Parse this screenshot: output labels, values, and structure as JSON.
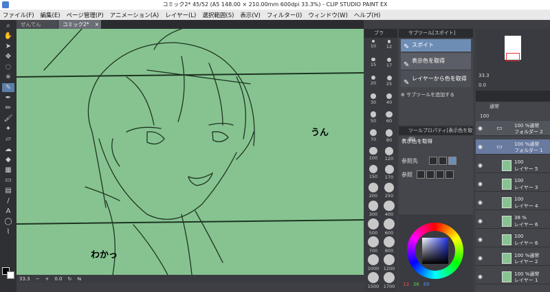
{
  "title": "コミック2* 45/52 (A5 148.00 × 210.00mm 600dpi 33.3%) - CLIP STUDIO PAINT EX",
  "menu": [
    "ファイル(F)",
    "編集(E)",
    "ページ管理(P)",
    "アニメーション(A)",
    "レイヤー(L)",
    "選択範囲(S)",
    "表示(V)",
    "フィルター(I)",
    "ウィンドウ(W)",
    "ヘルプ(H)"
  ],
  "tabs": [
    {
      "label": "ぜんでん"
    },
    {
      "label": "コミック2* 45/52",
      "close": "×"
    }
  ],
  "canvas": {
    "text1": "うん",
    "text2": "わかっ",
    "bg": "#86c390"
  },
  "status": {
    "zoom": "33.3",
    "angle": "0.0"
  },
  "brush_sizes": [
    "10",
    "12",
    "15",
    "17",
    "20",
    "25",
    "30",
    "40",
    "50",
    "60",
    "70",
    "80",
    "100",
    "120",
    "150",
    "170",
    "200",
    "250",
    "300",
    "400",
    "500",
    "600",
    "700",
    "800",
    "1000",
    "1200",
    "1500",
    "1700"
  ],
  "subtool": {
    "panel_title": "サブツール[スポイト]",
    "side_title": "ブラ",
    "tool_name": "スポイト",
    "items": [
      "表示色を取得",
      "レイヤーから色を取得"
    ],
    "add": "サブツールを追加する"
  },
  "toolprop": {
    "panel_title": "ツールプロパティ[表示色を取得]",
    "name": "表示色を取得",
    "ref_label": "参照先",
    "ref2_label": "参照"
  },
  "color": {
    "r": "13",
    "g": "36",
    "b": "69"
  },
  "navigator": {
    "zoom": "33.3",
    "angle": "0.0"
  },
  "layers": {
    "blend": "通常",
    "opacity": "100",
    "rows": [
      {
        "pct": "100 %通常",
        "name": "フォルダー 2",
        "type": "folder"
      },
      {
        "pct": "100 %通常",
        "name": "フォルダー 1",
        "type": "folder-sel"
      },
      {
        "pct": "100",
        "name": "レイヤー 5",
        "type": "layer"
      },
      {
        "pct": "100",
        "name": "レイヤー 3",
        "type": "layer"
      },
      {
        "pct": "100",
        "name": "レイヤー 4",
        "type": "layer"
      },
      {
        "pct": "38 %",
        "name": "レイヤー 6",
        "type": "layer"
      },
      {
        "pct": "100",
        "name": "レイヤー 6",
        "type": "layer"
      },
      {
        "pct": "100 %通常",
        "name": "レイヤー 2",
        "type": "layer"
      },
      {
        "pct": "100 %通常",
        "name": "レイヤー 1",
        "type": "layer"
      }
    ]
  }
}
